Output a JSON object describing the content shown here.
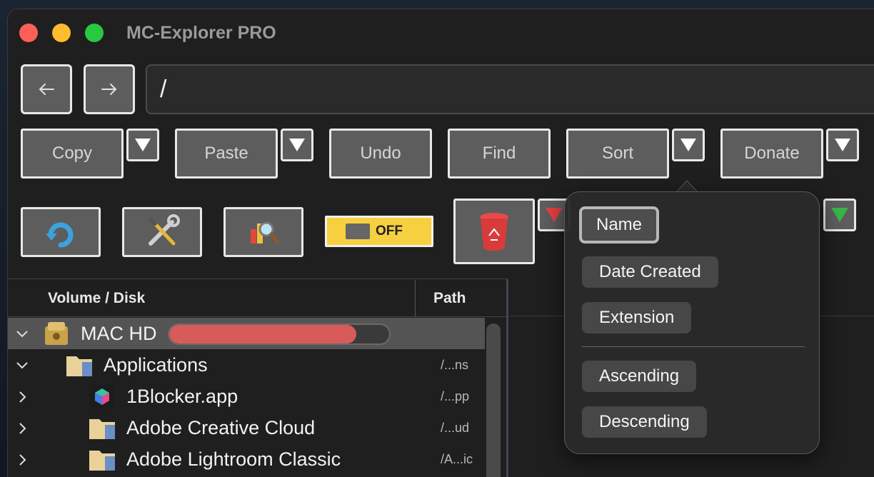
{
  "window": {
    "title": "MC-Explorer PRO"
  },
  "path_field": {
    "value": "/"
  },
  "actions": {
    "copy": "Copy",
    "paste": "Paste",
    "undo": "Undo",
    "find": "Find",
    "sort": "Sort",
    "donate": "Donate"
  },
  "toggle": {
    "label": "OFF"
  },
  "columns": {
    "volume": "Volume / Disk",
    "path": "Path"
  },
  "tree": [
    {
      "name": "MAC HD",
      "path": "",
      "icon": "disk-icon",
      "expanded": true,
      "disk_usage_pct": 85
    },
    {
      "name": "Applications",
      "path": "/...ns",
      "icon": "folder-icon",
      "expanded": true
    },
    {
      "name": "1Blocker.app",
      "path": "/...pp",
      "icon": "app-icon",
      "expanded": false
    },
    {
      "name": "Adobe Creative Cloud",
      "path": "/...ud",
      "icon": "folder-icon",
      "expanded": false
    },
    {
      "name": "Adobe Lightroom Classic",
      "path": "/A...ic",
      "icon": "folder-icon",
      "expanded": false
    }
  ],
  "sort_menu": {
    "fields": [
      "Name",
      "Date Created",
      "Extension"
    ],
    "selected_field": "Name",
    "orders": [
      "Ascending",
      "Descending"
    ]
  },
  "colors": {
    "accent_red": "#fe5f57",
    "accent_yellow": "#febc2e",
    "accent_green": "#28c840",
    "toggle_bg": "#f6d03f",
    "disk_fill": "#d85a5a"
  }
}
